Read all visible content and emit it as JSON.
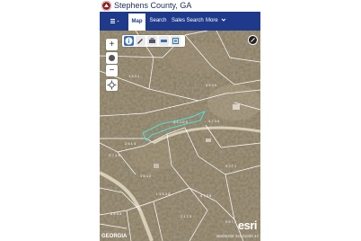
{
  "header": {
    "title": "Stephens County, GA"
  },
  "navbar": {
    "menu_icon": "hamburger-icon",
    "items": [
      {
        "label": "Map",
        "active": true
      },
      {
        "label": "Search",
        "active": false
      },
      {
        "label": "Sales Search",
        "active": false
      },
      {
        "label": "More",
        "active": false
      }
    ]
  },
  "map": {
    "zoom_in": "+",
    "zoom_out": "−",
    "tools": [
      "info-icon",
      "pencil-icon",
      "print-icon",
      "measure-icon",
      "layers-icon"
    ],
    "parcel_labels": [
      "1 3 3 1",
      "4 9 4 5",
      "A 5 1 0 3",
      "4 2 3 4",
      "2 6 1 4",
      "S 7 4 6",
      "3 2 7 1",
      "1 5 4 2",
      "L 1 5 3 8",
      "4 7 3 8",
      "3 6 5 4",
      "2 1 7 3",
      "2 9 7 3"
    ],
    "basemap_credit": "GEORGIA",
    "coordinates": "36606288 34531836 42",
    "brand": "esri",
    "highlight_color": "#4fe0d6",
    "parcel_line_color": "#ffffff"
  }
}
